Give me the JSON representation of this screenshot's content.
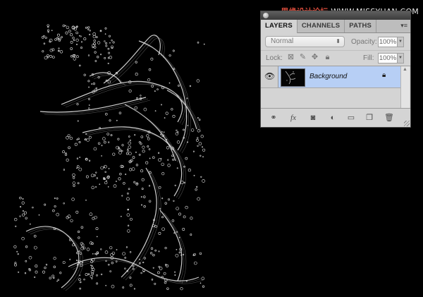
{
  "watermark": {
    "prefix": "思缘设计论坛",
    "site": "WWW.MISSYUAN.COM"
  },
  "panel": {
    "tabs": [
      {
        "label": "LAYERS"
      },
      {
        "label": "CHANNELS"
      },
      {
        "label": "PATHS"
      }
    ],
    "menu_icon": "panel-menu-icon",
    "blend_mode": "Normal",
    "opacity_label": "Opacity:",
    "opacity_value": "100%",
    "lock_label": "Lock:",
    "fill_label": "Fill:",
    "fill_value": "100%",
    "layers": [
      {
        "name": "Background",
        "visible": true,
        "locked": true,
        "selected": true
      }
    ],
    "selected_color": "#b7cff5"
  },
  "icons": {
    "lock_transparent": "lock-transparent-icon",
    "lock_paint": "lock-paint-icon",
    "lock_move": "lock-move-icon",
    "lock_all": "lock-all-icon",
    "link": "link-layers-icon",
    "fx": "fx-icon",
    "mask": "add-mask-icon",
    "adjustment": "adjustment-layer-icon",
    "group": "new-group-icon",
    "new_layer": "new-layer-icon",
    "trash": "trash-icon"
  }
}
